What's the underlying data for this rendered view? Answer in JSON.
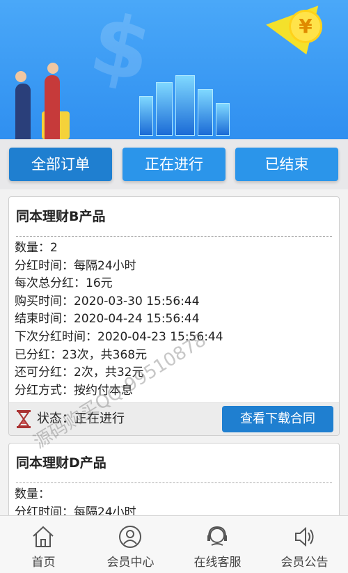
{
  "tabs": [
    {
      "label": "全部订单"
    },
    {
      "label": "正在进行"
    },
    {
      "label": "已结束"
    }
  ],
  "orders": [
    {
      "title": "同本理财B产品",
      "fields": [
        {
          "text": "数量：2"
        },
        {
          "text": "分红时间：每隔24小时"
        },
        {
          "text": "每次总分红：16元"
        },
        {
          "text": "购买时间：2020-03-30 15:56:44"
        },
        {
          "text": "结束时间：2020-04-24 15:56:44"
        },
        {
          "text": "下次分红时间：2020-04-23 15:56:44"
        },
        {
          "text": "已分红：23次，共368元"
        },
        {
          "text": "还可分红：2次，共32元"
        },
        {
          "text": "分红方式：按约付本息"
        }
      ],
      "status": "状态：正在进行",
      "contract_button": "查看下载合同"
    },
    {
      "title": "同本理财D产品",
      "fields": [
        {
          "text": "数量："
        },
        {
          "text": "分红时间：每隔24小时"
        }
      ]
    }
  ],
  "watermark": "源码购买QQ:99510878",
  "nav": [
    {
      "label": "首页",
      "icon": "home-icon"
    },
    {
      "label": "会员中心",
      "icon": "user-icon"
    },
    {
      "label": "在线客服",
      "icon": "headset-icon"
    },
    {
      "label": "会员公告",
      "icon": "speaker-icon"
    }
  ],
  "colors": {
    "accent": "#2b95ea",
    "accent_dark": "#1f7fd0",
    "banner": "#3a9af2"
  }
}
